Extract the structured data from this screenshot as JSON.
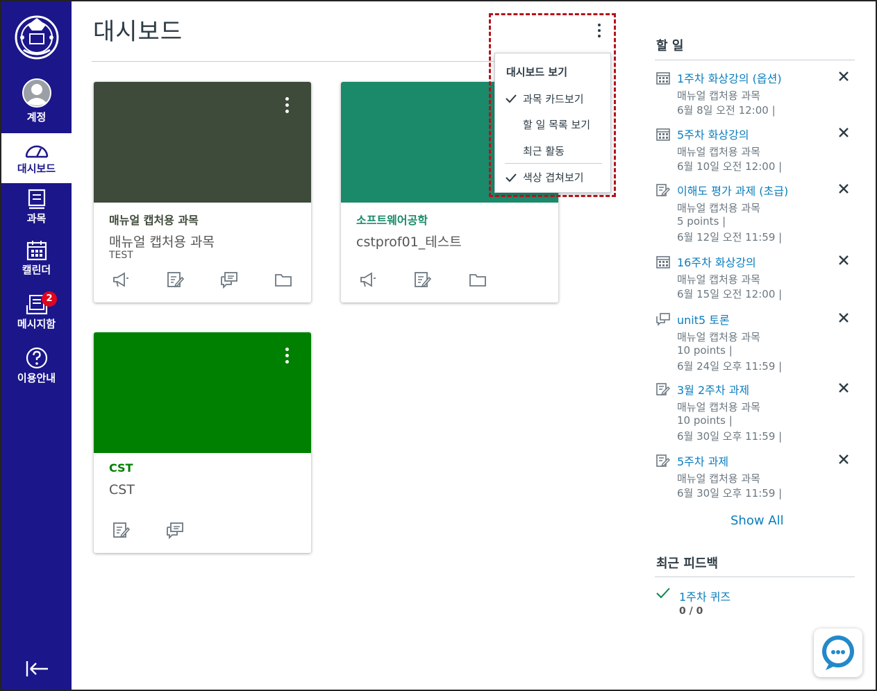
{
  "nav": {
    "account": "계정",
    "dashboard": "대시보드",
    "courses": "과목",
    "calendar": "캘린더",
    "inbox": "메시지함",
    "inbox_badge": "2",
    "help": "이용안내"
  },
  "page": {
    "title": "대시보드"
  },
  "menu": {
    "header": "대시보드 보기",
    "items": [
      {
        "label": "과목 카드보기",
        "checked": true
      },
      {
        "label": "할 일 목록 보기",
        "checked": false
      },
      {
        "label": "최근 활동",
        "checked": false
      }
    ],
    "color_overlay": {
      "label": "색상 겹쳐보기",
      "checked": true
    }
  },
  "cards": [
    {
      "title": "매뉴얼 캡처용 과목",
      "subtitle": "매뉴얼 캡처용 과목",
      "term": "TEST",
      "color": "#3e4a3a",
      "title_color": "#3e4a3a",
      "icons": [
        "announcement-icon",
        "assignment-icon",
        "discussion-icon",
        "files-icon"
      ]
    },
    {
      "title": "소프트웨어공학",
      "subtitle": "cstprof01_테스트",
      "term": "",
      "color": "#1a8a6a",
      "title_color": "#1a8a6a",
      "icons": [
        "announcement-icon",
        "assignment-icon",
        "files-icon"
      ]
    },
    {
      "title": "CST",
      "subtitle": "CST",
      "term": "",
      "color": "#008000",
      "title_color": "#008000",
      "icons": [
        "assignment-icon",
        "discussion-icon"
      ]
    }
  ],
  "todo": {
    "title": "할 일",
    "items": [
      {
        "icon": "calendar-icon",
        "title": "1주차 화상강의 (옵션)",
        "lines": [
          "매뉴얼 캡처용 과목",
          "6월 8일 오전 12:00  |"
        ]
      },
      {
        "icon": "calendar-icon",
        "title": "5주차 화상강의",
        "lines": [
          "매뉴얼 캡처용 과목",
          "6월 10일 오전 12:00  |"
        ]
      },
      {
        "icon": "assignment-icon",
        "title": "이해도 평가 과제 (초급)",
        "lines": [
          "매뉴얼 캡처용 과목",
          "5 points  |",
          "6월 12일 오전 11:59  |"
        ]
      },
      {
        "icon": "calendar-icon",
        "title": "16주차 화상강의",
        "lines": [
          "매뉴얼 캡처용 과목",
          "6월 15일 오전 12:00  |"
        ]
      },
      {
        "icon": "discussion-icon",
        "title": "unit5 토론",
        "lines": [
          "매뉴얼 캡처용 과목",
          "10 points  |",
          "6월 24일 오후 11:59  |"
        ]
      },
      {
        "icon": "assignment-icon",
        "title": "3월 2주차 과제",
        "lines": [
          "매뉴얼 캡처용 과목",
          "10 points  |",
          "6월 30일 오후 11:59  |"
        ]
      },
      {
        "icon": "assignment-icon",
        "title": "5주차 과제",
        "lines": [
          "매뉴얼 캡처용 과목",
          "6월 30일 오후 11:59  |"
        ]
      }
    ],
    "show_all": "Show All"
  },
  "feedback": {
    "title": "최근 피드백",
    "items": [
      {
        "title": "1주차 퀴즈",
        "score": "0 / 0"
      }
    ]
  },
  "colors": {
    "nav": "#1b168a",
    "link": "#0a7dbd",
    "highlight": "#b5121b"
  }
}
